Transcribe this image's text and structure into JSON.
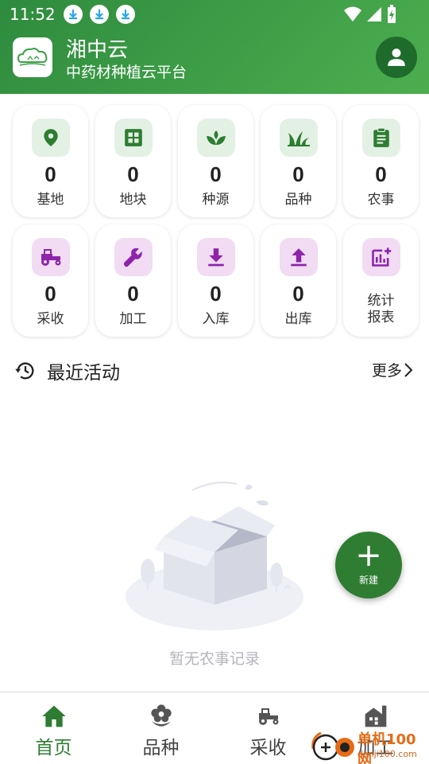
{
  "status_bar": {
    "time": "11:52",
    "download_icons": [
      "download-icon",
      "download-icon",
      "download-icon"
    ],
    "right_icons": [
      "wifi-icon",
      "signal-icon",
      "battery-charging-icon"
    ]
  },
  "header": {
    "title": "湘中云",
    "subtitle": "中药材种植云平台",
    "logo_icon": "cloud-landscape-logo",
    "profile_icon": "person-icon"
  },
  "stats": [
    {
      "icon": "location-pin-icon",
      "count": "0",
      "label": "基地",
      "tone": "green"
    },
    {
      "icon": "grid-icon",
      "count": "0",
      "label": "地块",
      "tone": "green"
    },
    {
      "icon": "sprout-icon",
      "count": "0",
      "label": "种源",
      "tone": "green"
    },
    {
      "icon": "grass-icon",
      "count": "0",
      "label": "品种",
      "tone": "green"
    },
    {
      "icon": "clipboard-icon",
      "count": "0",
      "label": "农事",
      "tone": "green"
    },
    {
      "icon": "tractor-icon",
      "count": "0",
      "label": "采收",
      "tone": "purple"
    },
    {
      "icon": "wrench-icon",
      "count": "0",
      "label": "加工",
      "tone": "purple"
    },
    {
      "icon": "download-icon",
      "count": "0",
      "label": "入库",
      "tone": "purple"
    },
    {
      "icon": "upload-icon",
      "count": "0",
      "label": "出库",
      "tone": "purple"
    },
    {
      "icon": "chart-add-icon",
      "label_line1": "统计",
      "label_line2": "报表",
      "tone": "purple"
    }
  ],
  "recent": {
    "title": "最近活动",
    "more": "更多",
    "empty_text": "暂无农事记录"
  },
  "fab": {
    "label": "新建",
    "icon": "plus-icon"
  },
  "nav": [
    {
      "label": "首页",
      "icon": "home-icon",
      "active": true
    },
    {
      "label": "品种",
      "icon": "flower-icon",
      "active": false
    },
    {
      "label": "采收",
      "icon": "tractor-icon",
      "active": false
    },
    {
      "label": "加工",
      "icon": "factory-icon",
      "active": false
    }
  ],
  "watermark": {
    "text": "单机100网",
    "sub": "danji100.com"
  },
  "colors": {
    "primary": "#2e7d32",
    "header_start": "#2e8b3e",
    "header_end": "#4cae4f",
    "green_icon": "#2e7d32",
    "green_tile": "#e3f1e4",
    "purple_icon": "#8e24aa",
    "purple_tile": "#f1dcf3"
  }
}
